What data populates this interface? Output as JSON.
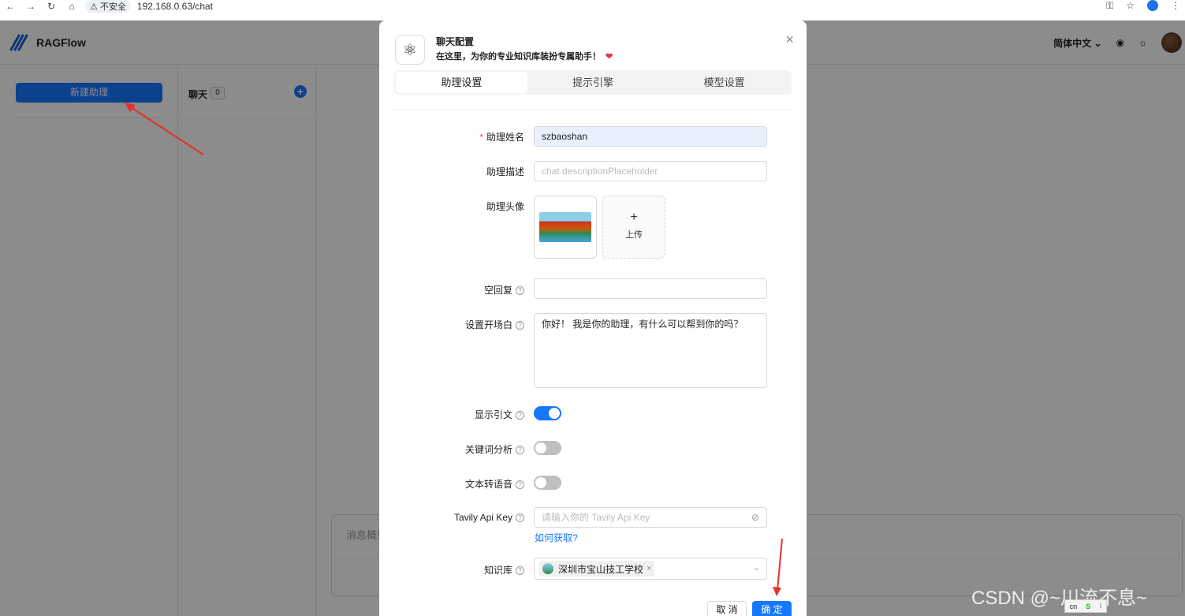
{
  "browser": {
    "security_label": "不安全",
    "url": "192.168.0.63/chat"
  },
  "app": {
    "brand": "RAGFlow",
    "language": "简体中文",
    "new_assistant": "新建助理",
    "chat_label": "聊天",
    "chat_count": "0",
    "message_placeholder": "消息概要"
  },
  "modal": {
    "title": "聊天配置",
    "subtitle": "在这里，为你的专业知识库装扮专属助手！",
    "tabs": [
      {
        "label": "助理设置",
        "active": true
      },
      {
        "label": "提示引擎",
        "active": false
      },
      {
        "label": "模型设置",
        "active": false
      }
    ],
    "fields": {
      "name_label": "助理姓名",
      "name_value": "szbaoshan",
      "desc_label": "助理描述",
      "desc_placeholder": "chat.descriptionPlaceholder",
      "avatar_label": "助理头像",
      "upload_label": "上传",
      "empty_reply_label": "空回复",
      "opener_label": "设置开场白",
      "opener_value": "你好！ 我是你的助理，有什么可以帮到你的吗？",
      "show_quote_label": "显示引文",
      "show_quote_on": true,
      "keyword_label": "关键词分析",
      "keyword_on": false,
      "tts_label": "文本转语音",
      "tts_on": false,
      "tavily_label": "Tavily Api Key",
      "tavily_placeholder": "请输入你的 Tavily Api Key",
      "how_to_get": "如何获取?",
      "kb_label": "知识库",
      "kb_value": "深圳市宝山技工学校"
    },
    "cancel": "取 消",
    "confirm": "确 定"
  },
  "watermark": "CSDN @~川流不息~",
  "ime_label": "cn",
  "colors": {
    "primary": "#1677ff",
    "arrow": "#e5302a"
  }
}
